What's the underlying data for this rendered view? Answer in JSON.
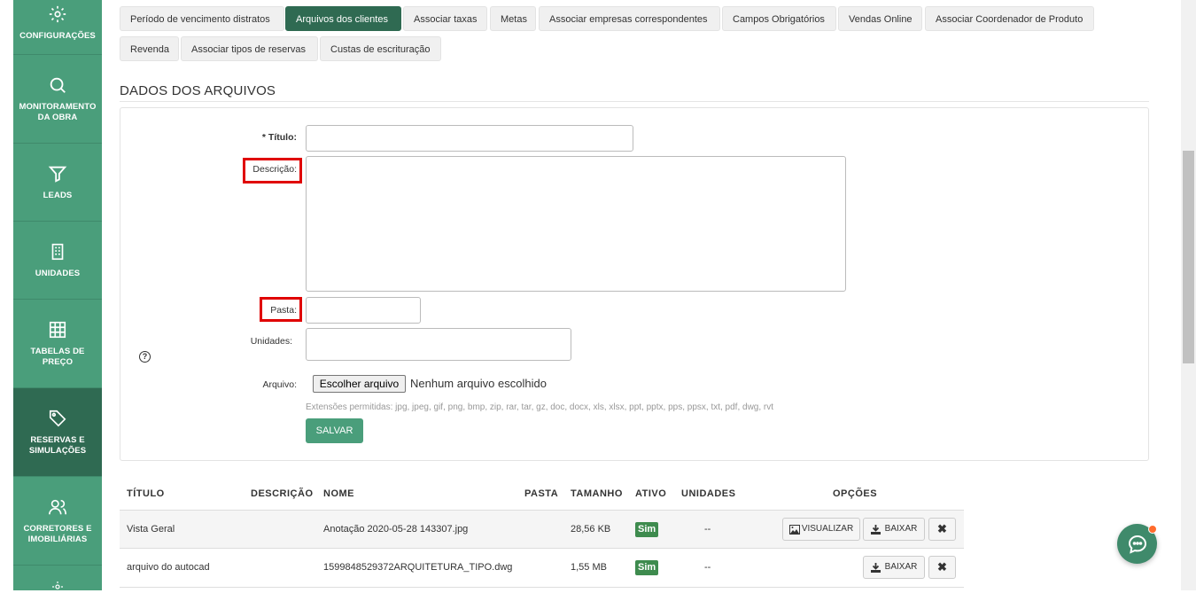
{
  "sidebar": {
    "items": [
      {
        "label": "Configurações",
        "icon": "gear-icon"
      },
      {
        "label": "Monitoramento da obra",
        "icon": "search-icon"
      },
      {
        "label": "Leads",
        "icon": "funnel-icon"
      },
      {
        "label": "Unidades",
        "icon": "building-icon"
      },
      {
        "label": "Tabelas de preço",
        "icon": "grid-icon"
      },
      {
        "label": "Reservas e simulações",
        "icon": "tag-icon",
        "active": true
      },
      {
        "label": "Corretores e imobiliárias",
        "icon": "users-icon"
      }
    ]
  },
  "tabs": [
    {
      "label": "Período de vencimento distratos"
    },
    {
      "label": "Arquivos dos clientes",
      "active": true
    },
    {
      "label": "Associar taxas"
    },
    {
      "label": "Metas"
    },
    {
      "label": "Associar empresas correspondentes"
    },
    {
      "label": "Campos Obrigatórios"
    },
    {
      "label": "Vendas Online"
    },
    {
      "label": "Associar Coordenador de Produto"
    },
    {
      "label": "Revenda"
    },
    {
      "label": "Associar tipos de reservas"
    },
    {
      "label": "Custas de escrituração"
    }
  ],
  "section_title": "DADOS DOS ARQUIVOS",
  "form": {
    "titulo_label": "* Título:",
    "descricao_label": "Descrição:",
    "pasta_label": "Pasta:",
    "unidades_label": "Unidades:",
    "arquivo_label": "Arquivo:",
    "file_button": "Escolher arquivo",
    "file_status": "Nenhum arquivo escolhido",
    "extensions_hint": "Extensões permitidas: jpg, jpeg, gif, png, bmp, zip, rar, tar, gz, doc, docx, xls, xlsx, ppt, pptx, pps, ppsx, txt, pdf, dwg, rvt",
    "save_label": "SALVAR",
    "help_glyph": "?"
  },
  "table": {
    "headers": [
      "TÍTULO",
      "DESCRIÇÃO",
      "NOME",
      "PASTA",
      "TAMANHO",
      "ATIVO",
      "UNIDADES",
      "OPÇÕES"
    ],
    "rows": [
      {
        "titulo": "Vista Geral",
        "descricao": "",
        "nome": "Anotação 2020-05-28 143307.jpg",
        "pasta": "",
        "tamanho": "28,56 KB",
        "ativo": "Sim",
        "unidades": "--",
        "visualizar": "VISUALIZAR",
        "baixar": "BAIXAR",
        "remove": "✖"
      },
      {
        "titulo": "arquivo do autocad",
        "descricao": "",
        "nome": "1599848529372ARQUITETURA_TIPO.dwg",
        "pasta": "",
        "tamanho": "1,55 MB",
        "ativo": "Sim",
        "unidades": "--",
        "baixar": "BAIXAR",
        "remove": "✖"
      }
    ]
  },
  "colors": {
    "sidebar": "#4a9e7b",
    "active": "#2f6a52",
    "badge": "#3e8b4e",
    "highlight": "#e00000"
  }
}
